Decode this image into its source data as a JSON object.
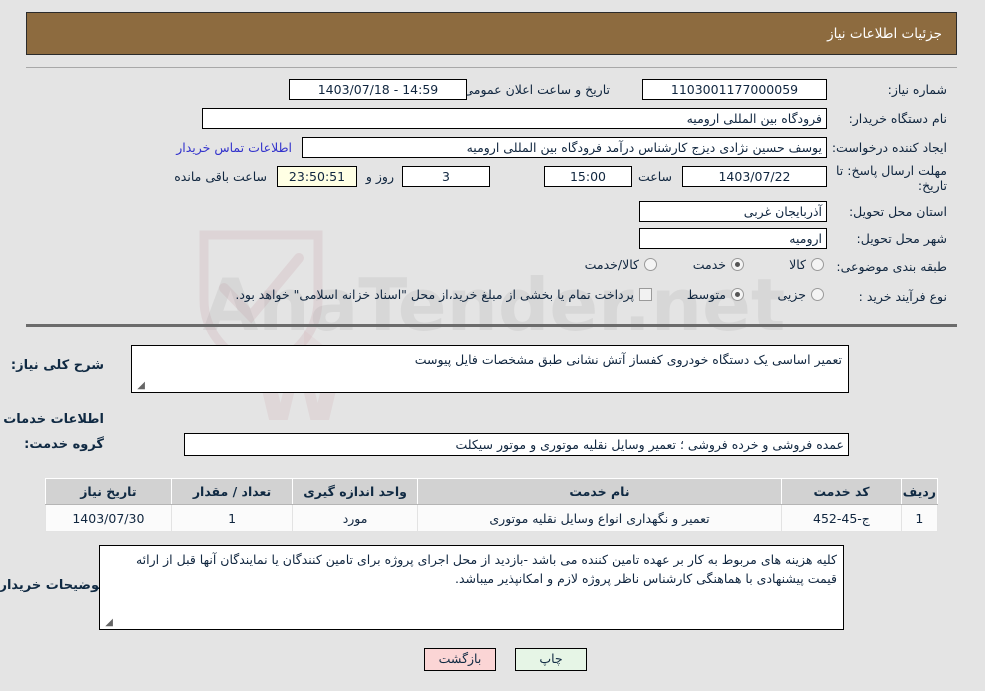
{
  "header": {
    "title": "جزئیات اطلاعات نیاز"
  },
  "form": {
    "need_number_label": "شماره نیاز:",
    "need_number_value": "1103001177000059",
    "buyer_org_label": "نام دستگاه خریدار:",
    "buyer_org_value": "فرودگاه بین المللی ارومیه",
    "creator_label": "ایجاد کننده درخواست:",
    "creator_value": "یوسف حسین نژادی دیزج کارشناس درآمد فرودگاه بین المللی ارومیه",
    "deadline_label": "مهلت ارسال پاسخ: تا تاریخ:",
    "deadline_date": "1403/07/22",
    "hour_label": "ساعت",
    "hour_value": "15:00",
    "days_value": "3",
    "days_label": "روز و",
    "countdown_value": "23:50:51",
    "countdown_label": "ساعت باقی مانده",
    "public_announce_label": "تاریخ و ساعت اعلان عمومی:",
    "public_announce_value": "14:59 - 1403/07/18",
    "empty_field_value": "",
    "contact_link": "اطلاعات تماس خریدار",
    "province_label": "استان محل تحویل:",
    "province_value": "آذربایجان غربی",
    "city_label": "شهر محل تحویل:",
    "city_value": "ارومیه",
    "category_label": "طبقه بندی موضوعی:",
    "category_options": [
      {
        "label": "کالا",
        "selected": false
      },
      {
        "label": "خدمت",
        "selected": true
      },
      {
        "label": "کالا/خدمت",
        "selected": false
      }
    ],
    "process_label": "نوع فرآیند خرید :",
    "process_options": [
      {
        "label": "جزیی",
        "selected": false
      },
      {
        "label": "متوسط",
        "selected": true
      }
    ],
    "treasury_checkbox_checked": false,
    "treasury_text": "پرداخت تمام یا بخشی از مبلغ خرید،از محل \"اسناد خزانه اسلامی\" خواهد بود."
  },
  "body": {
    "general_desc_label": "شرح کلی نیاز:",
    "general_desc_value": "تعمیر اساسی یک دستگاه خودروی کفساز آتش نشانی طبق مشخصات فایل پیوست",
    "services_info_heading": "اطلاعات خدمات مورد نیاز",
    "service_group_label": "گروه خدمت:",
    "service_group_value": "عمده فروشی و خرده فروشی ؛ تعمیر وسایل نقلیه موتوری و موتور سیکلت",
    "buyer_notes_label": "توضیحات خریدار:",
    "buyer_notes_value": "کلیه هزینه های مربوط به کار بر عهده تامین کننده می باشد -بازدید از محل اجرای پروژه برای تامین کنندگان یا نمایندگان آنها قبل از ارائه قیمت پیشنهادی با هماهنگی کارشناس ناظر پروژه لازم و امکانپذیر  میباشد."
  },
  "table": {
    "columns": [
      "ردیف",
      "کد خدمت",
      "نام خدمت",
      "واحد اندازه گیری",
      "تعداد / مقدار",
      "تاریخ نیاز"
    ],
    "rows": [
      {
        "radif": "1",
        "code": "ج-45-452",
        "name": "تعمیر و نگهداری انواع وسایل نقلیه موتوری",
        "unit": "مورد",
        "qty": "1",
        "date": "1403/07/30"
      }
    ]
  },
  "footer": {
    "print_label": "چاپ",
    "back_label": "بازگشت"
  },
  "watermark": {
    "text": "AnaTender.net"
  },
  "colors": {
    "header_bg": "#8d6b3f",
    "page_bg": "#e4e4e4",
    "link": "#3333cc",
    "countdown_bg": "#ffffe4",
    "print_btn_bg": "#e6f5e6",
    "back_btn_bg": "#fbd5d5",
    "table_header_bg": "#d2d2d2"
  }
}
